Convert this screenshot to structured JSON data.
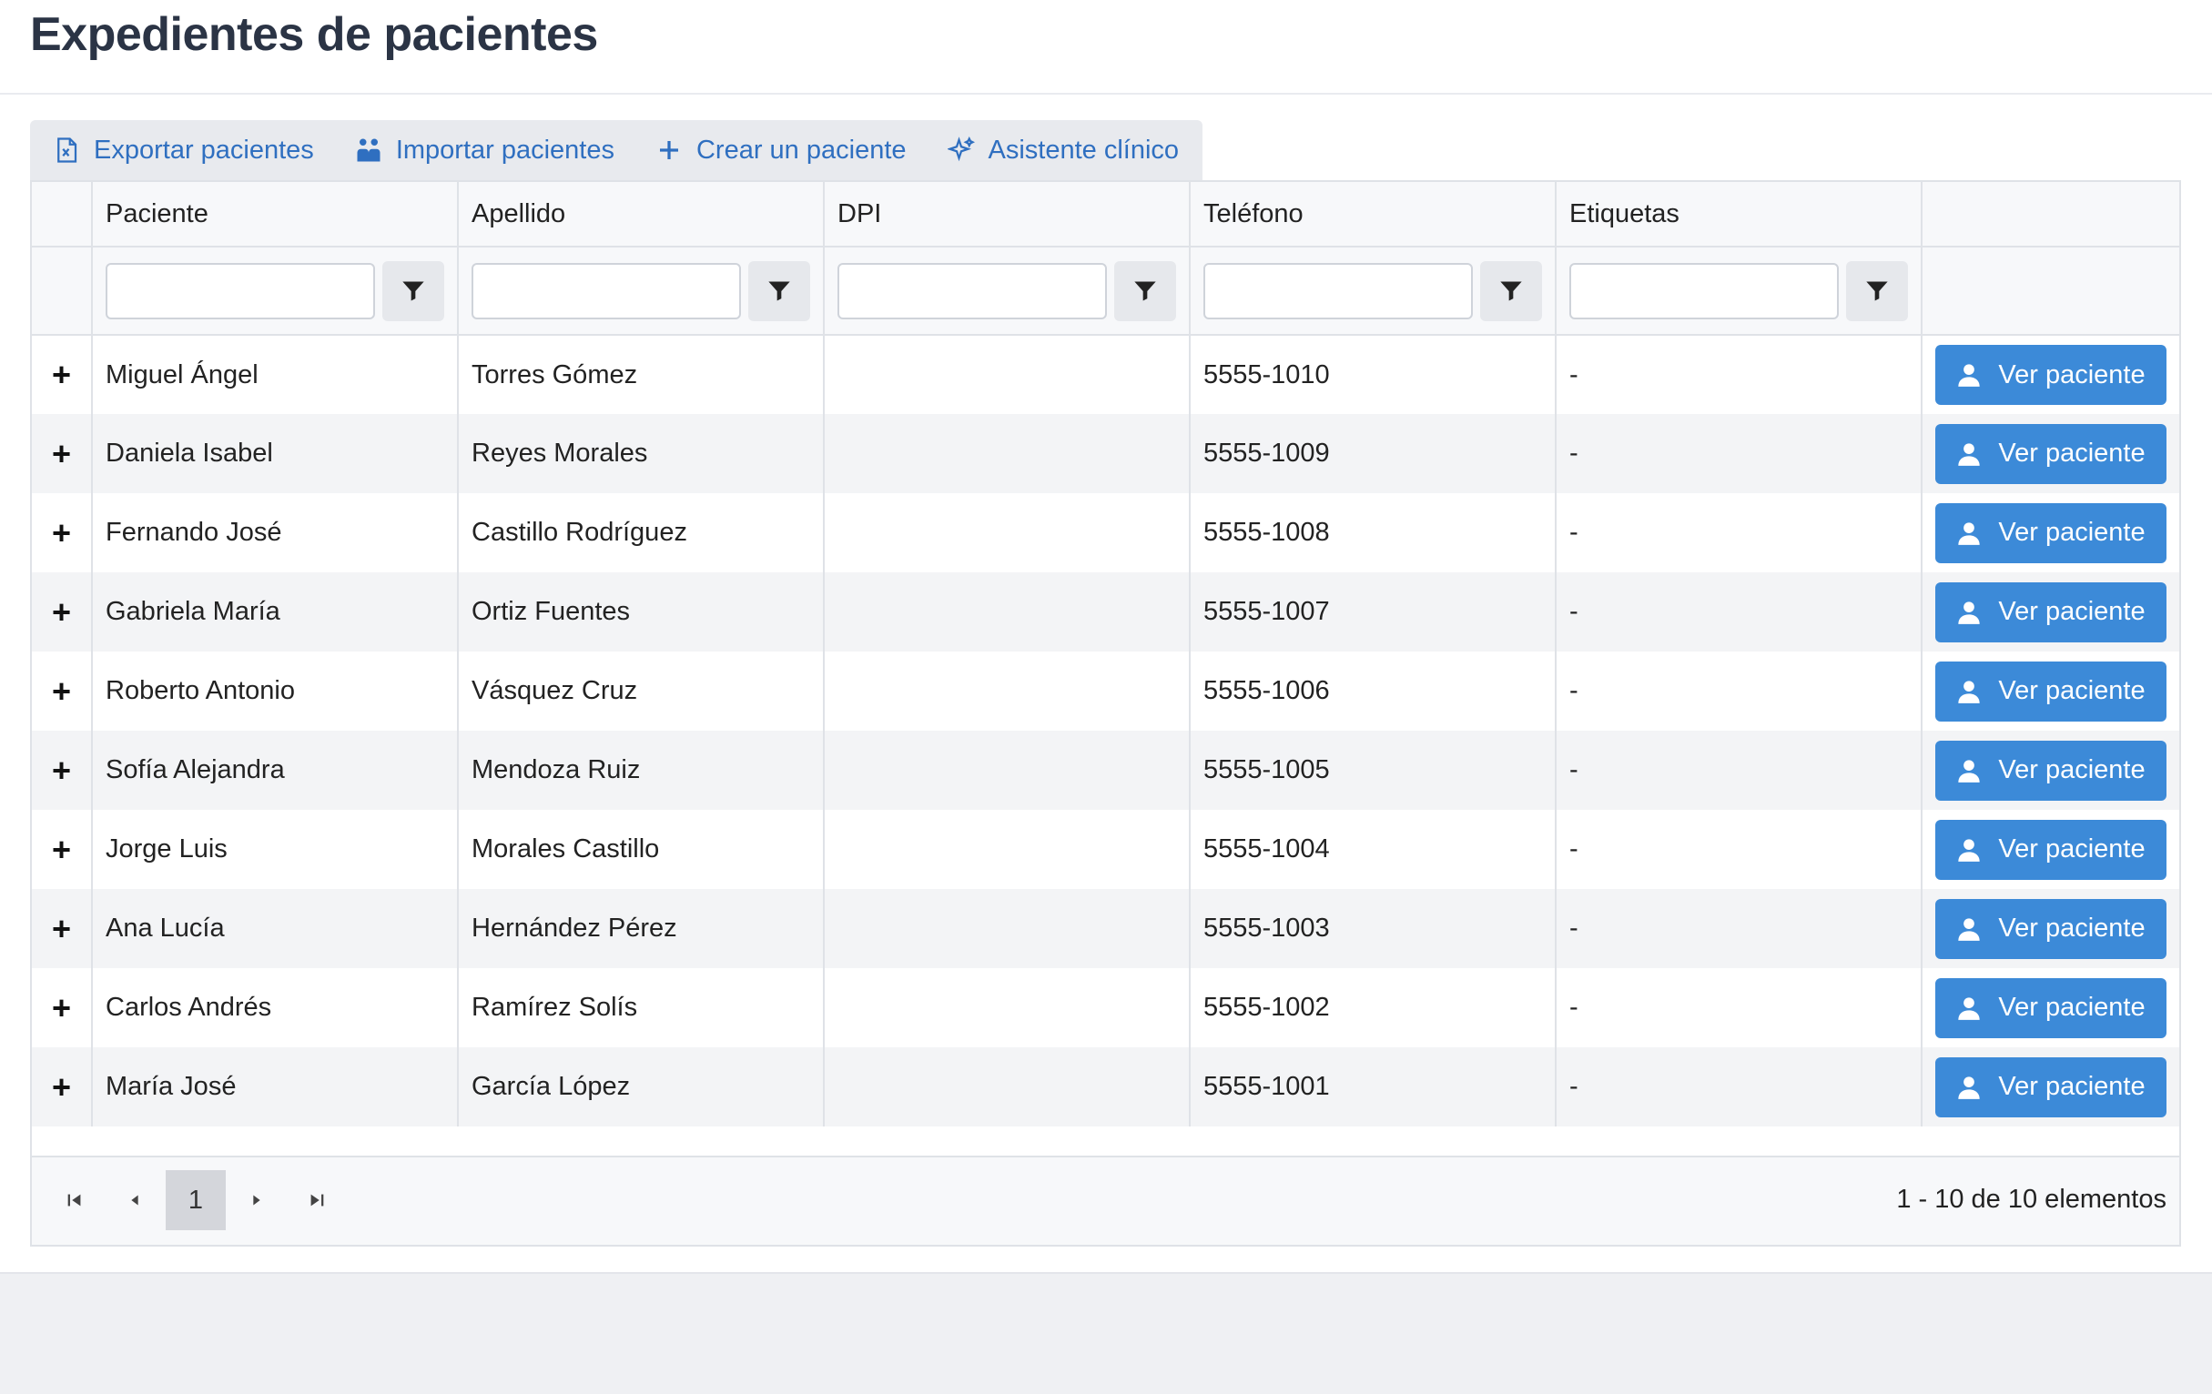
{
  "header": {
    "title": "Expedientes de pacientes"
  },
  "toolbar": {
    "export_label": "Exportar pacientes",
    "import_label": "Importar pacientes",
    "create_label": "Crear un paciente",
    "assistant_label": "Asistente clínico"
  },
  "grid": {
    "columns": [
      "Paciente",
      "Apellido",
      "DPI",
      "Teléfono",
      "Etiquetas"
    ],
    "action_label": "Ver paciente",
    "rows": [
      {
        "nombre": "Miguel Ángel",
        "apellido": "Torres Gómez",
        "dpi": "",
        "telefono": "5555-1010",
        "etiquetas": "-"
      },
      {
        "nombre": "Daniela Isabel",
        "apellido": "Reyes Morales",
        "dpi": "",
        "telefono": "5555-1009",
        "etiquetas": "-"
      },
      {
        "nombre": "Fernando José",
        "apellido": "Castillo Rodríguez",
        "dpi": "",
        "telefono": "5555-1008",
        "etiquetas": "-"
      },
      {
        "nombre": "Gabriela María",
        "apellido": "Ortiz Fuentes",
        "dpi": "",
        "telefono": "5555-1007",
        "etiquetas": "-"
      },
      {
        "nombre": "Roberto Antonio",
        "apellido": "Vásquez Cruz",
        "dpi": "",
        "telefono": "5555-1006",
        "etiquetas": "-"
      },
      {
        "nombre": "Sofía Alejandra",
        "apellido": "Mendoza Ruiz",
        "dpi": "",
        "telefono": "5555-1005",
        "etiquetas": "-"
      },
      {
        "nombre": "Jorge Luis",
        "apellido": "Morales Castillo",
        "dpi": "",
        "telefono": "5555-1004",
        "etiquetas": "-"
      },
      {
        "nombre": "Ana Lucía",
        "apellido": "Hernández Pérez",
        "dpi": "",
        "telefono": "5555-1003",
        "etiquetas": "-"
      },
      {
        "nombre": "Carlos Andrés",
        "apellido": "Ramírez Solís",
        "dpi": "",
        "telefono": "5555-1002",
        "etiquetas": "-"
      },
      {
        "nombre": "María José",
        "apellido": "García López",
        "dpi": "",
        "telefono": "5555-1001",
        "etiquetas": "-"
      }
    ]
  },
  "pager": {
    "current_page": "1",
    "info": "1 - 10 de 10 elementos"
  },
  "colors": {
    "accent": "#3c8ad8",
    "link": "#2f6fc0",
    "title": "#2b3445"
  }
}
